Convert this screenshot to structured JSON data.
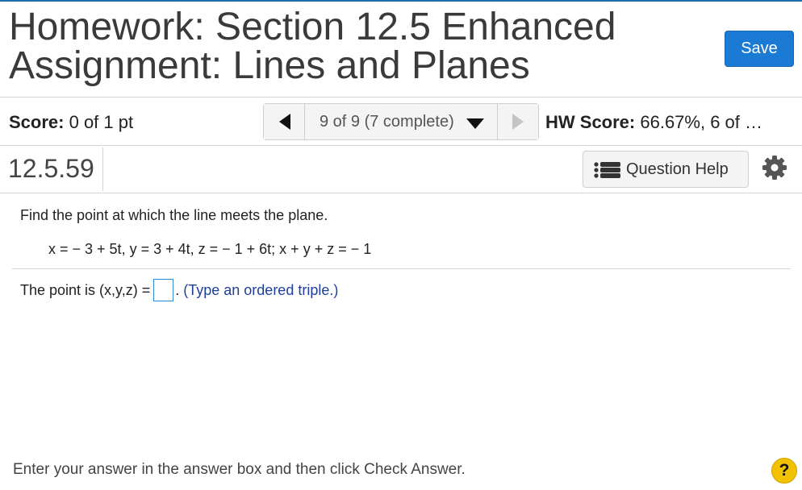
{
  "header": {
    "title": "Homework: Section 12.5 Enhanced Assignment: Lines and Planes",
    "save_label": "Save"
  },
  "score_bar": {
    "score_label": "Score:",
    "score_value": " 0 of 1 pt",
    "nav_select_label": "9 of 9 (7 complete)",
    "hw_score_label": "HW Score:",
    "hw_score_value": " 66.67%, 6 of …"
  },
  "question_bar": {
    "question_number": "12.5.59",
    "help_label": "Question Help"
  },
  "question": {
    "prompt": "Find the point at which the line meets the plane.",
    "equation": "x = − 3 + 5t, y = 3 + 4t, z = − 1 + 6t; x + y + z = − 1",
    "answer_prefix": "The point is (x,y,z) =",
    "answer_value": "",
    "answer_suffix": ".",
    "answer_hint": "(Type an ordered triple.)"
  },
  "footer": {
    "instruction": "Enter your answer in the answer box and then click Check Answer.",
    "help_symbol": "?"
  },
  "colors": {
    "accent": "#1a7ad4",
    "top_border": "#1a6fb0",
    "hint_text": "#1f3f99",
    "help_circle": "#f2c200"
  },
  "icons": {
    "prev": "triangle-left-icon",
    "next": "triangle-right-icon",
    "dropdown": "chevron-down-icon",
    "help": "list-icon",
    "settings": "gear-icon",
    "footer_help": "question-mark-icon"
  }
}
